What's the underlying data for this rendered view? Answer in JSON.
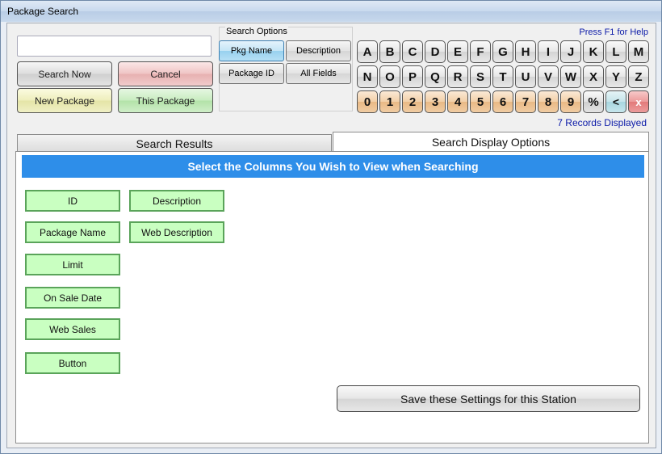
{
  "window": {
    "title": "Package Search"
  },
  "search": {
    "value": "",
    "placeholder": ""
  },
  "buttons": {
    "search_now": "Search Now",
    "cancel": "Cancel",
    "new_package": "New Package",
    "this_package": "This Package"
  },
  "search_options": {
    "legend": "Search Options",
    "items": [
      {
        "label": "Pkg Name",
        "selected": true
      },
      {
        "label": "Description",
        "selected": false
      },
      {
        "label": "Package ID",
        "selected": false
      },
      {
        "label": "All Fields",
        "selected": false
      }
    ]
  },
  "help_text": "Press F1 for Help",
  "records_text": "7 Records Displayed",
  "keyboard": {
    "row1": [
      "A",
      "B",
      "C",
      "D",
      "E",
      "F",
      "G",
      "H",
      "I",
      "J",
      "K",
      "L",
      "M"
    ],
    "row2": [
      "N",
      "O",
      "P",
      "Q",
      "R",
      "S",
      "T",
      "U",
      "V",
      "W",
      "X",
      "Y",
      "Z"
    ],
    "row3": [
      "0",
      "1",
      "2",
      "3",
      "4",
      "5",
      "6",
      "7",
      "8",
      "9"
    ],
    "percent": "%",
    "backspace": "<",
    "clear": "x"
  },
  "tabs": {
    "results": "Search Results",
    "display": "Search Display Options",
    "active": "display"
  },
  "display_options": {
    "banner": "Select the Columns You Wish to View when Searching",
    "columns_left": [
      "ID",
      "Package Name",
      "Limit",
      "On Sale Date",
      "Web Sales",
      "Button"
    ],
    "columns_right": [
      "Description",
      "Web Description"
    ],
    "save_label": "Save these Settings for this Station"
  },
  "colors": {
    "accent_blue": "#2e8ee9",
    "column_green": "#c9ffc1",
    "link_blue": "#0b1aa8"
  }
}
